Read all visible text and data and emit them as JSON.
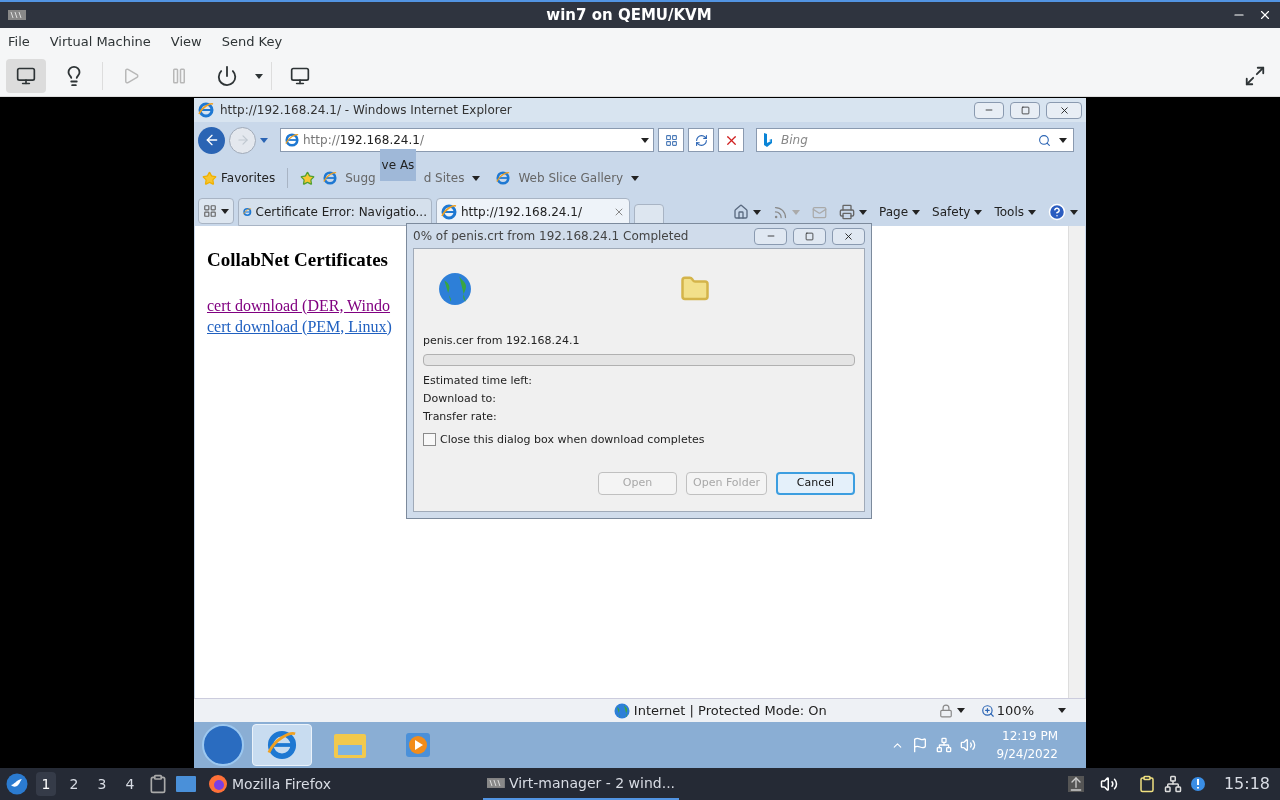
{
  "window": {
    "title": "win7 on QEMU/KVM"
  },
  "menu": [
    "File",
    "Virtual Machine",
    "View",
    "Send Key"
  ],
  "toolbar": [
    {
      "kind": "console",
      "selected": true,
      "disabled": false
    },
    {
      "kind": "details",
      "selected": false,
      "disabled": false
    },
    {
      "kind": "run",
      "selected": false,
      "disabled": true
    },
    {
      "kind": "pause",
      "selected": false,
      "disabled": true
    },
    {
      "kind": "power",
      "selected": false,
      "disabled": false
    },
    {
      "kind": "snapshots",
      "selected": false,
      "disabled": false
    }
  ],
  "ie": {
    "title": "http://192.168.24.1/ - Windows Internet Explorer",
    "address": {
      "prefix": "http://",
      "host": "192.168.24.1",
      "suffix": "/"
    },
    "search": {
      "placeholder": "Bing"
    },
    "favorites": {
      "label": "Favorites",
      "suggested_left": "Sugg",
      "suggested_right": "d Sites",
      "tooltip": "ve As",
      "web_slice": "Web Slice Gallery"
    },
    "tabs": [
      {
        "label": "Certificate Error: Navigatio...",
        "selected": false
      },
      {
        "label": "http://192.168.24.1/",
        "selected": true
      }
    ],
    "commands": [
      "Page",
      "Safety",
      "Tools"
    ],
    "page": {
      "heading": "CollabNet Certificates",
      "links": [
        {
          "text": "cert download (DER, Windo",
          "visited": true
        },
        {
          "text": "cert download (PEM, Linux)",
          "visited": false
        }
      ]
    },
    "status": {
      "zone": "Internet | Protected Mode: On",
      "zoom": "100%"
    }
  },
  "dialog": {
    "title": "0% of penis.crt from 192.168.24.1 Completed",
    "source": "penis.cer from 192.168.24.1",
    "level": 0,
    "fields": [
      "Estimated time left:",
      "Download to:",
      "Transfer rate:"
    ],
    "checkbox": {
      "label": "Close this dialog box when download completes",
      "checked": false
    },
    "buttons": [
      {
        "label": "Open",
        "disabled": true,
        "default": false
      },
      {
        "label": "Open Folder",
        "disabled": true,
        "default": false
      },
      {
        "label": "Cancel",
        "disabled": false,
        "default": true
      }
    ]
  },
  "win_taskbar": {
    "items": [
      {
        "kind": "ie",
        "selected": true
      },
      {
        "kind": "explorer",
        "selected": false
      },
      {
        "kind": "media",
        "selected": false
      }
    ],
    "time": "12:19 PM",
    "date": "9/24/2022"
  },
  "panel": {
    "workspaces": [
      {
        "label": "1",
        "selected": true
      },
      {
        "label": "2",
        "selected": false
      },
      {
        "label": "3",
        "selected": false
      },
      {
        "label": "4",
        "selected": false
      }
    ],
    "tasks": [
      {
        "label": "Mozilla Firefox",
        "selected": false
      },
      {
        "label": "Virt-manager - 2 wind...",
        "selected": true
      }
    ],
    "clock": "15:18"
  }
}
